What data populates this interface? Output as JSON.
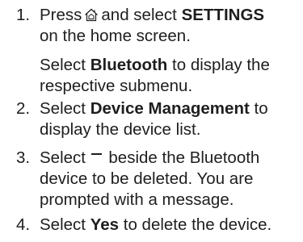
{
  "steps": [
    {
      "number": "1.",
      "icon": "home-icon",
      "line1_pre": "Press",
      "line1_post": "and select",
      "line1_bold": "SETTINGS",
      "line2": "on the home screen.",
      "sub_line1_pre": "Select",
      "sub_line1_bold": "Bluetooth",
      "sub_line1_post": "to display the",
      "sub_line2": "respective submenu."
    },
    {
      "number": "2.",
      "line1_pre": "Select",
      "line1_bold": "Device Management",
      "line1_post": "to",
      "line2": "display the device list."
    },
    {
      "number": "3.",
      "icon": "minus-icon",
      "line1_pre": "Select",
      "line1_post": "beside the Bluetooth",
      "line2": "device to be deleted. You are",
      "line3": "prompted with a message."
    },
    {
      "number": "4.",
      "line1_pre": "Select",
      "line1_bold": "Yes",
      "line1_post": "to delete the device."
    }
  ]
}
